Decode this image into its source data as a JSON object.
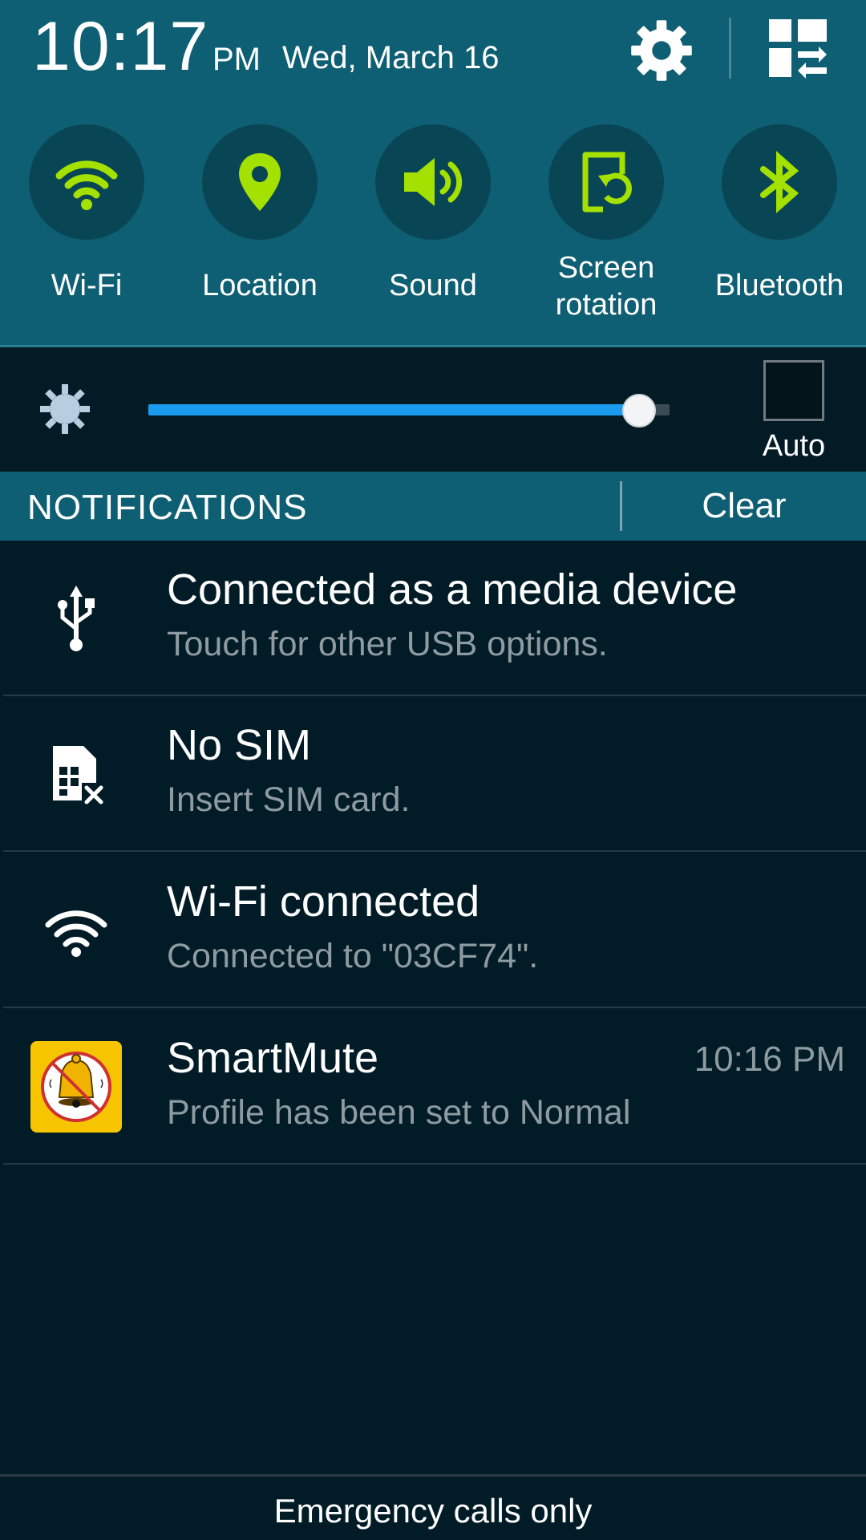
{
  "status": {
    "time": "10:17",
    "ampm": "PM",
    "date": "Wed, March 16"
  },
  "header_icons": [
    "gear-icon",
    "grid-edit-icon"
  ],
  "quick_settings": [
    {
      "label": "Wi-Fi",
      "icon": "wifi-icon"
    },
    {
      "label": "Location",
      "icon": "location-pin-icon"
    },
    {
      "label": "Sound",
      "icon": "speaker-icon"
    },
    {
      "label_line1": "Screen",
      "label_line2": "rotation",
      "icon": "screen-rotation-icon"
    },
    {
      "label": "Bluetooth",
      "icon": "bluetooth-icon"
    }
  ],
  "brightness": {
    "level": 0.94,
    "auto_label": "Auto",
    "auto_checked": false
  },
  "notifications_header": {
    "title": "NOTIFICATIONS",
    "clear_label": "Clear"
  },
  "notifications": [
    {
      "title": "Connected as a media device",
      "subtitle": "Touch for other USB options.",
      "icon": "usb-icon"
    },
    {
      "title": "No SIM",
      "subtitle": "Insert SIM card.",
      "icon": "no-sim-icon"
    },
    {
      "title": "Wi-Fi connected",
      "subtitle": "Connected to \"03CF74\".",
      "icon": "wifi-icon"
    },
    {
      "title": "SmartMute",
      "subtitle": "Profile has been set to Normal",
      "time": "10:16 PM",
      "icon": "smartmute-app-icon"
    }
  ],
  "footer": {
    "text": "Emergency calls only"
  },
  "colors": {
    "panel": "#0e5f73",
    "background": "#021c27",
    "accent_green": "#a4e000",
    "slider_blue": "#1a9bf0"
  }
}
